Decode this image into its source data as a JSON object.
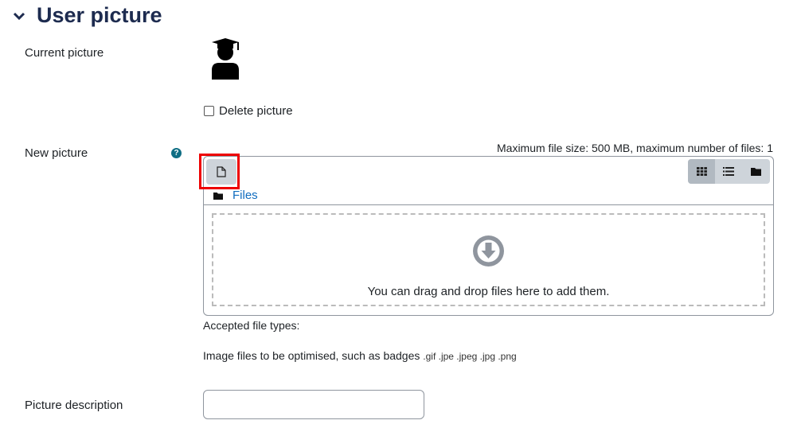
{
  "section": {
    "title": "User picture",
    "chevron_icon": "chevron-down-icon"
  },
  "current_picture": {
    "label": "Current picture",
    "image_icon": "graduate-user-icon"
  },
  "delete_picture": {
    "label": "Delete picture",
    "checked": false
  },
  "new_picture": {
    "label": "New picture",
    "help_icon": "question-circle-icon",
    "max_info": "Maximum file size: 500 MB, maximum number of files: 1"
  },
  "filepicker": {
    "add_icon": "file-icon",
    "views": [
      {
        "icon": "grid-icon",
        "active": true
      },
      {
        "icon": "list-icon",
        "active": false
      },
      {
        "icon": "folder-icon",
        "active": false
      }
    ],
    "breadcrumb": "Files",
    "drop_icon": "arrow-circle-down-icon",
    "drop_text": "You can drag and drop files here to add them.",
    "highlight_color": "#ee0000"
  },
  "accepted": {
    "label": "Accepted file types:",
    "desc": "Image files to be optimised, such as badges",
    "extensions": ".gif .jpe .jpeg .jpg .png"
  },
  "picture_description": {
    "label": "Picture description",
    "value": ""
  }
}
